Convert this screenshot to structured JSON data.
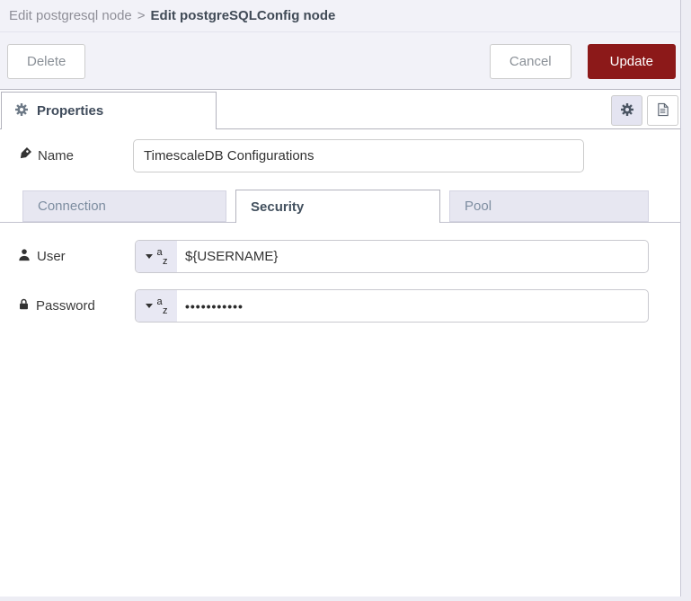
{
  "header": {
    "breadcrumb": {
      "parent": "Edit postgresql node",
      "separator": ">",
      "current": "Edit postgreSQLConfig node"
    }
  },
  "toolbar": {
    "delete": "Delete",
    "cancel": "Cancel",
    "update": "Update"
  },
  "tray": {
    "properties_tab": "Properties",
    "icon_buttons": [
      "gear-icon",
      "document-icon"
    ]
  },
  "form": {
    "name": {
      "label": "Name",
      "value": "TimescaleDB Configurations"
    },
    "tabs": [
      {
        "label": "Connection",
        "active": false
      },
      {
        "label": "Security",
        "active": true
      },
      {
        "label": "Pool",
        "active": false
      }
    ],
    "fields": {
      "user": {
        "label": "User",
        "value": "${USERNAME}",
        "type": {
          "top": "a",
          "bottom": "z"
        }
      },
      "password": {
        "label": "Password",
        "value": "•••••••••••",
        "type": {
          "top": "a",
          "bottom": "z"
        }
      }
    }
  },
  "icons": {
    "name_field": "tag-icon",
    "user_field": "user-icon",
    "password_field": "lock-icon",
    "properties_tab": "gear-icon",
    "edit_button": "gear-icon",
    "description_button": "document-icon",
    "typed_input": "chevron-down-icon"
  },
  "colors": {
    "update_button_bg": "#8C1919",
    "header_bg": "#f2f2f8",
    "inactive_tab_bg": "#e7e7f1",
    "typed_button_bg": "#e8e8f3",
    "panel_border": "#b3b3bd"
  }
}
